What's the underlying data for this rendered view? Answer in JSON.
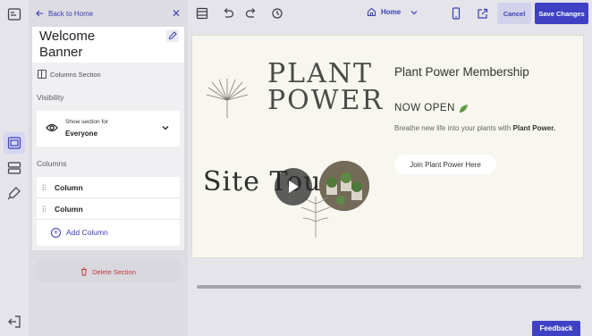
{
  "panel": {
    "back_label": "Back to Home",
    "section_title": "Welcome Banner",
    "section_type": "Columns Section",
    "visibility_label": "Visibility",
    "visibility_small": "Show section for",
    "visibility_value": "Everyone",
    "columns_label": "Columns",
    "columns": [
      {
        "label": "Column"
      },
      {
        "label": "Column"
      }
    ],
    "add_column": "Add Column",
    "delete_section": "Delete Section"
  },
  "toolbar": {
    "page_select": "Home",
    "cancel_label": "Cancel",
    "save_label": "Save Changes"
  },
  "preview": {
    "logo_line1": "PLANT",
    "logo_line2": "POWER",
    "video_text": "Site Tour",
    "title": "Plant Power Membership",
    "open": "NOW OPEN",
    "desc_prefix": "Breathe new life into your plants with ",
    "desc_bold": "Plant Power.",
    "cta": "Join Plant Power Here"
  },
  "feedback_label": "Feedback",
  "colors": {
    "accent": "#3f41c4",
    "danger": "#c03a3a",
    "canvas_bg": "#f7f6ef"
  }
}
